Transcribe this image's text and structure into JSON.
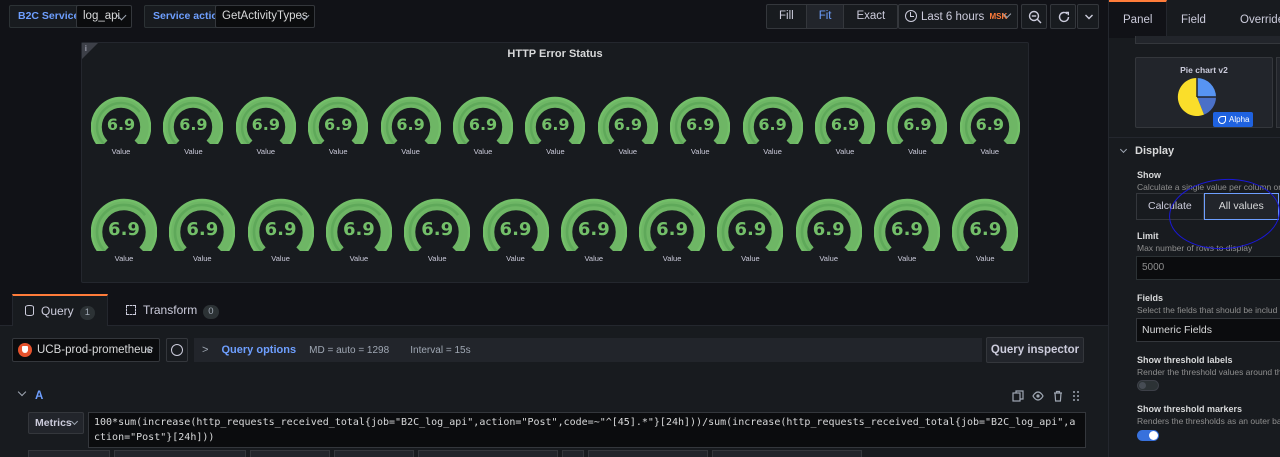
{
  "variables": [
    {
      "label": "B2C Service",
      "value": "log_api"
    },
    {
      "label": "Service action",
      "value": "GetActivityTypes"
    }
  ],
  "view_modes": {
    "options": [
      "Fill",
      "Fit",
      "Exact"
    ],
    "selected": "Fit"
  },
  "time_picker": {
    "range": "Last 6 hours",
    "timezone": "MSK"
  },
  "toolbar_icons": [
    "zoom-out-icon",
    "refresh-icon",
    "chevron-down-icon"
  ],
  "panel": {
    "title": "HTTP Error Status",
    "info_glyph": "i",
    "gauge_color": "#73bf69",
    "gauge_value_fraction": 0.69,
    "gauge_rows": [
      {
        "count": 13,
        "value": "6.9",
        "label": "Value"
      },
      {
        "count": 12,
        "value": "6.9",
        "label": "Value"
      }
    ]
  },
  "query_tabs": [
    {
      "label": "Query",
      "count": "1",
      "active": true
    },
    {
      "label": "Transform",
      "count": "0",
      "active": false
    }
  ],
  "datasource": {
    "name": "UCB-prod-prometheus"
  },
  "query_options": {
    "title": "Query options",
    "md": "MD = auto = 1298",
    "interval": "Interval = 15s",
    "arrow": ">"
  },
  "query_inspector_label": "Query inspector",
  "query": {
    "ref_id": "A",
    "metrics_label": "Metrics",
    "expr": "100*sum(increase(http_requests_received_total{job=\"B2C_log_api\",action=\"Post\",code=~\"^[45].*\"}[24h]))/sum(increase(http_requests_received_total{job=\"B2C_log_api\",action=\"Post\"}[24h]))"
  },
  "options_pane": {
    "tabs": [
      {
        "label": "Panel",
        "active": true
      },
      {
        "label": "Field",
        "active": false
      },
      {
        "label": "Overrides",
        "active": false
      }
    ],
    "viz_card": {
      "title": "Pie chart v2",
      "badge": "Alpha"
    },
    "section": "Display",
    "show": {
      "title": "Show",
      "desc": "Calculate a single value per column or",
      "options": [
        "Calculate",
        "All values"
      ],
      "selected": "All values"
    },
    "limit": {
      "title": "Limit",
      "desc": "Max number of rows to display",
      "placeholder": "5000"
    },
    "fields": {
      "title": "Fields",
      "desc": "Select the fields that should be includ",
      "value": "Numeric Fields"
    },
    "threshold_labels": {
      "title": "Show threshold labels",
      "desc": "Render the threshold values around the",
      "enabled": false
    },
    "threshold_markers": {
      "title": "Show threshold markers",
      "desc": "Renders the thresholds as an outer ba",
      "enabled": true
    }
  }
}
